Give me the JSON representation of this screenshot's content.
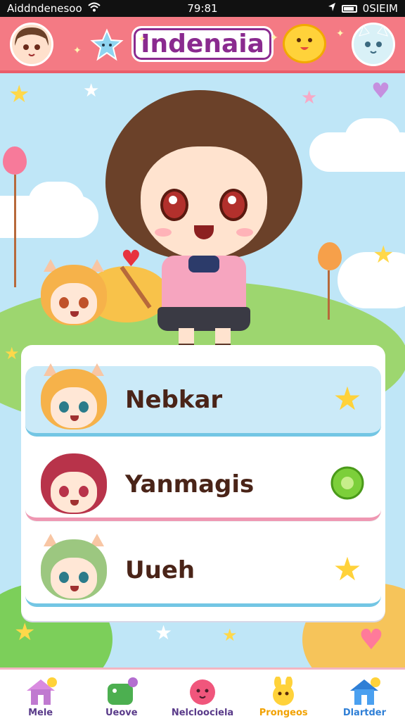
{
  "status_bar": {
    "carrier": "Aiddndenesoo",
    "time": "79:81",
    "right_text": "0SIEIM"
  },
  "header": {
    "title": "Indenaia"
  },
  "characters": [
    {
      "name": "Nebkar",
      "badge_icon": "star-icon",
      "hair_color": "#f6b24a",
      "eye_color": "#2b8a8a"
    },
    {
      "name": "Yanmagis",
      "badge_icon": "clover-icon",
      "hair_color": "#b8334a",
      "eye_color": "#b8334a"
    },
    {
      "name": "Uueh",
      "badge_icon": "star-icon",
      "hair_color": "#9cc780",
      "eye_color": "#2b8a8a"
    }
  ],
  "bottom_nav": [
    {
      "label": "Mele",
      "icon": "house-icon",
      "color": "#c07ad0"
    },
    {
      "label": "Ueove",
      "icon": "dino-icon",
      "color": "#3a9a3a"
    },
    {
      "label": "Nelcloociela",
      "icon": "blob-icon",
      "color": "#f0567c"
    },
    {
      "label": "Prongeos",
      "icon": "bunny-icon",
      "color": "#f2a200"
    },
    {
      "label": "Dlartder",
      "icon": "blue-house-icon",
      "color": "#2f7fd6"
    }
  ],
  "colors": {
    "header": "#f47a84",
    "sky": "#bfe6f7",
    "title_text": "#8a2a8f",
    "name_text": "#4a2418"
  }
}
